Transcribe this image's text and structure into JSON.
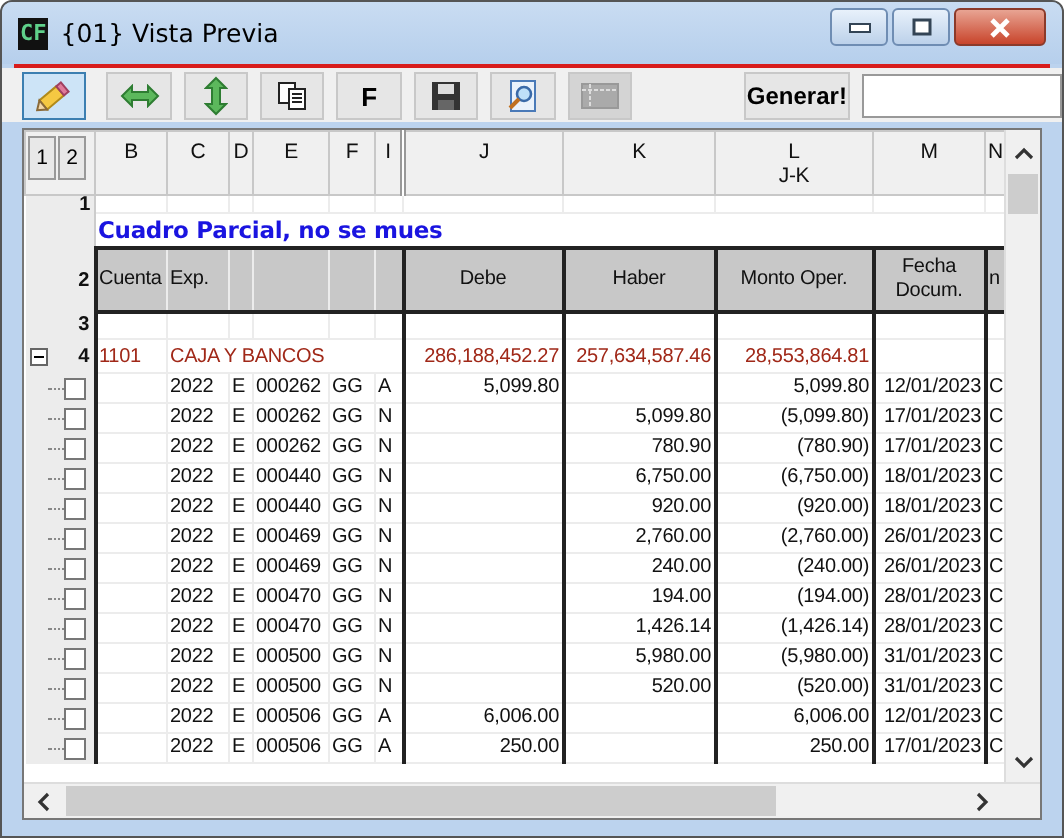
{
  "window": {
    "app_icon": "CF",
    "title": "{01} Vista Previa"
  },
  "toolbar": {
    "buttons": [
      {
        "kind": "pencil",
        "selected": true,
        "disabled": false
      },
      {
        "kind": "h-arrows",
        "selected": false,
        "disabled": false
      },
      {
        "kind": "v-arrows",
        "selected": false,
        "disabled": false
      },
      {
        "kind": "copy",
        "selected": false,
        "disabled": false
      },
      {
        "kind": "text",
        "label": "F",
        "selected": false,
        "disabled": false
      },
      {
        "kind": "save",
        "selected": false,
        "disabled": false
      },
      {
        "kind": "preview",
        "selected": false,
        "disabled": false
      },
      {
        "kind": "grid",
        "selected": false,
        "disabled": true
      }
    ],
    "generate_button": "Generar!"
  },
  "outline_levels": [
    "1",
    "2"
  ],
  "columns": [
    {
      "letter": "B"
    },
    {
      "letter": "C"
    },
    {
      "letter": "D"
    },
    {
      "letter": "E"
    },
    {
      "letter": "F"
    },
    {
      "letter": "I"
    },
    {
      "letter": "J"
    },
    {
      "letter": "K"
    },
    {
      "letter": "L",
      "sub": "J-K"
    },
    {
      "letter": "M"
    },
    {
      "letter": "N"
    }
  ],
  "first_row": {
    "number": "1",
    "text": "Cuadro Parcial, no se mues"
  },
  "header_row": {
    "number": "2",
    "cuenta": "Cuenta",
    "exp": "Exp.",
    "debe": "Debe",
    "haber": "Haber",
    "monto": "Monto Oper.",
    "fecha": "Fecha Docum.",
    "col_n": "n"
  },
  "blank_row": {
    "number": "3"
  },
  "group": {
    "number": "4",
    "expanded": true,
    "cuenta": "1101",
    "name": "CAJA Y BANCOS",
    "debe": "286,188,452.27",
    "haber": "257,634,587.46",
    "monto": "28,553,864.81"
  },
  "rows": [
    {
      "checked": false,
      "year": "2022",
      "type": "E",
      "doc": "000262",
      "code": "GG",
      "flag": "A",
      "debe": "5,099.80",
      "monto": "5,099.80",
      "fecha": "12/01/2023",
      "col_n": "C"
    },
    {
      "checked": false,
      "year": "2022",
      "type": "E",
      "doc": "000262",
      "code": "GG",
      "flag": "N",
      "haber": "5,099.80",
      "monto": "(5,099.80)",
      "fecha": "17/01/2023",
      "col_n": "C"
    },
    {
      "checked": false,
      "year": "2022",
      "type": "E",
      "doc": "000262",
      "code": "GG",
      "flag": "N",
      "haber": "780.90",
      "monto": "(780.90)",
      "fecha": "17/01/2023",
      "col_n": "C"
    },
    {
      "checked": false,
      "year": "2022",
      "type": "E",
      "doc": "000440",
      "code": "GG",
      "flag": "N",
      "haber": "6,750.00",
      "monto": "(6,750.00)",
      "fecha": "18/01/2023",
      "col_n": "C"
    },
    {
      "checked": false,
      "year": "2022",
      "type": "E",
      "doc": "000440",
      "code": "GG",
      "flag": "N",
      "haber": "920.00",
      "monto": "(920.00)",
      "fecha": "18/01/2023",
      "col_n": "C"
    },
    {
      "checked": false,
      "year": "2022",
      "type": "E",
      "doc": "000469",
      "code": "GG",
      "flag": "N",
      "haber": "2,760.00",
      "monto": "(2,760.00)",
      "fecha": "26/01/2023",
      "col_n": "C"
    },
    {
      "checked": false,
      "year": "2022",
      "type": "E",
      "doc": "000469",
      "code": "GG",
      "flag": "N",
      "haber": "240.00",
      "monto": "(240.00)",
      "fecha": "26/01/2023",
      "col_n": "C"
    },
    {
      "checked": false,
      "year": "2022",
      "type": "E",
      "doc": "000470",
      "code": "GG",
      "flag": "N",
      "haber": "194.00",
      "monto": "(194.00)",
      "fecha": "28/01/2023",
      "col_n": "C"
    },
    {
      "checked": false,
      "year": "2022",
      "type": "E",
      "doc": "000470",
      "code": "GG",
      "flag": "N",
      "haber": "1,426.14",
      "monto": "(1,426.14)",
      "fecha": "28/01/2023",
      "col_n": "C"
    },
    {
      "checked": false,
      "year": "2022",
      "type": "E",
      "doc": "000500",
      "code": "GG",
      "flag": "N",
      "haber": "5,980.00",
      "monto": "(5,980.00)",
      "fecha": "31/01/2023",
      "col_n": "C"
    },
    {
      "checked": false,
      "year": "2022",
      "type": "E",
      "doc": "000500",
      "code": "GG",
      "flag": "N",
      "haber": "520.00",
      "monto": "(520.00)",
      "fecha": "31/01/2023",
      "col_n": "C"
    },
    {
      "checked": false,
      "year": "2022",
      "type": "E",
      "doc": "000506",
      "code": "GG",
      "flag": "A",
      "debe": "6,006.00",
      "monto": "6,006.00",
      "fecha": "12/01/2023",
      "col_n": "C"
    },
    {
      "checked": false,
      "year": "2022",
      "type": "E",
      "doc": "000506",
      "code": "GG",
      "flag": "A",
      "debe": "250.00",
      "monto": "250.00",
      "fecha": "17/01/2023",
      "col_n": "C"
    }
  ]
}
